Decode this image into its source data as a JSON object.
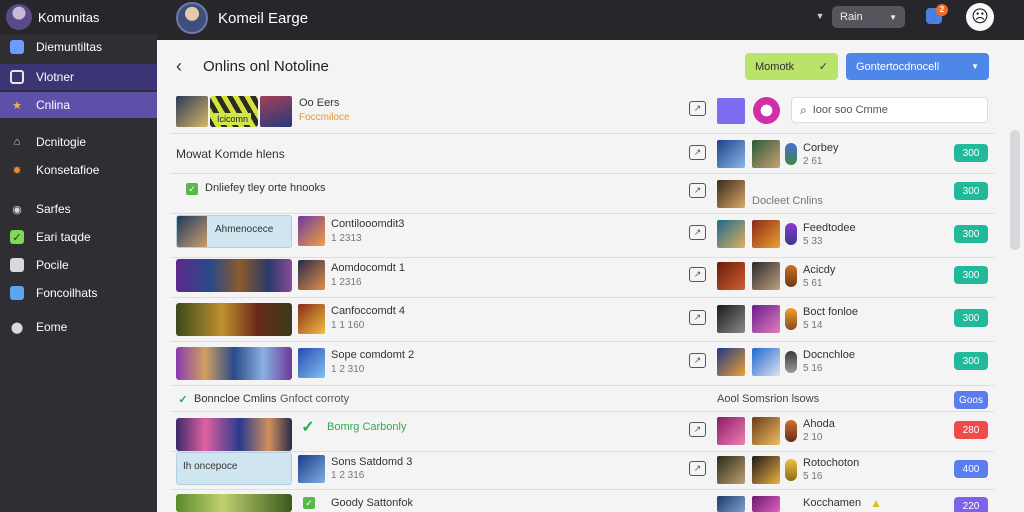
{
  "app": {
    "name": "Komunitas"
  },
  "header": {
    "title": "Komeil Earge",
    "search_label": "Rain",
    "notif_count": "2"
  },
  "sidebar": {
    "items": [
      {
        "label": "Diemuntiltas",
        "icon": "grid-icon",
        "color": "#6d9cff"
      },
      {
        "label": "Vlotner",
        "icon": "box-icon",
        "color": "#e6e6e6"
      },
      {
        "label": "Cnlina",
        "icon": "star-icon",
        "color": "#f2b340"
      },
      {
        "label": "Dcnitogie",
        "icon": "home-icon",
        "color": "#d9d9d9"
      },
      {
        "label": "Konsetafioe",
        "icon": "spark-icon",
        "color": "#f08a3c"
      },
      {
        "label": "Sarfes",
        "icon": "circle-icon",
        "color": "#d9d9d9"
      },
      {
        "label": "Eari taqde",
        "icon": "check-icon",
        "color": "#7ed957"
      },
      {
        "label": "Pocile",
        "icon": "doc-icon",
        "color": "#d9d9d9"
      },
      {
        "label": "Foncoilhats",
        "icon": "calendar-icon",
        "color": "#5aa7f0"
      },
      {
        "label": "Eome",
        "icon": "shield-icon",
        "color": "#d9d9d9"
      }
    ]
  },
  "main": {
    "title": "Onlins onl Notoline",
    "btn_green": "Momotk",
    "btn_blue": "Gontertocdnocell",
    "search_placeholder": "Ioor soo Cmme",
    "colors": {
      "green": "#22b89a",
      "blue": "#5b7df0",
      "red": "#ef4b4b",
      "purple": "#7d63e8"
    },
    "rows": [
      {
        "name": "Oo Eers",
        "sub": "Foccmiloce",
        "badge_text": "Icicomn",
        "right_name": "",
        "right_sub": "",
        "pill": ""
      },
      {
        "name": "Mowat Komde hlens",
        "sub": "",
        "right_name": "Corbey",
        "right_sub": "2 61",
        "pill": "300"
      },
      {
        "name": "Dnliefey tley orte hnooks",
        "sub": "",
        "right_name": "Docleet Cnlins",
        "right_sub": "",
        "pill": "300"
      },
      {
        "name": "Contilooomdit3",
        "sub": "1 2313",
        "banner": "Ahmenocece",
        "right_name": "Feedtodee",
        "right_sub": "5 33",
        "pill": "300"
      },
      {
        "name": "Aomdocomdt 1",
        "sub": "1 2316",
        "right_name": "Acicdy",
        "right_sub": "5 61",
        "pill": "300"
      },
      {
        "name": "Canfoccomdt 4",
        "sub": "1 1 160",
        "right_name": "Boct fonloe",
        "right_sub": "5 14",
        "pill": "300"
      },
      {
        "name": "Sope comdomt 2",
        "sub": "1 2 310",
        "right_name": "Docnchloe",
        "right_sub": "5 16",
        "pill": "300"
      },
      {
        "name": "Bonncloe Cmlins",
        "sub": "Gnfoct corroty",
        "right_name": "Aool Somsrion lsows",
        "right_sub": "",
        "pill": "Goos"
      },
      {
        "name": "Bomrg Carbonly",
        "sub": "",
        "right_name": "Ahoda",
        "right_sub": "2 10",
        "pill": "280"
      },
      {
        "name": "Sons Satdomd 3",
        "sub": "1 2 316",
        "banner": "Ih oncepoce",
        "right_name": "Rotochoton",
        "right_sub": "5 16",
        "pill": "400"
      },
      {
        "name": "Goody Sattonfok",
        "sub": "",
        "right_name": "Kocchamen",
        "right_sub": "",
        "pill": "220"
      }
    ]
  }
}
